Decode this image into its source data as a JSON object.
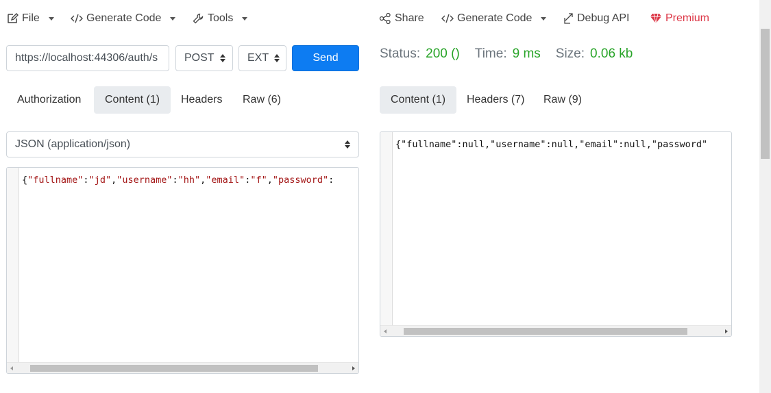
{
  "menu_left": {
    "file": "File",
    "generate_code": "Generate Code",
    "tools": "Tools"
  },
  "menu_right": {
    "share": "Share",
    "generate_code": "Generate Code",
    "debug_api": "Debug API",
    "premium": "Premium"
  },
  "request": {
    "url": "https://localhost:44306/auth/s",
    "method": "POST",
    "ext": "EXT",
    "send_label": "Send"
  },
  "request_tabs": [
    {
      "label": "Authorization",
      "active": false
    },
    {
      "label": "Content (1)",
      "active": true
    },
    {
      "label": "Headers",
      "active": false
    },
    {
      "label": "Raw (6)",
      "active": false
    }
  ],
  "content_type": "JSON (application/json)",
  "request_body": {
    "brace": "{",
    "k1": "\"fullname\"",
    "v1": "\"jd\"",
    "k2": "\"username\"",
    "v2": "\"hh\"",
    "k3": "\"email\"",
    "v3": "\"f\"",
    "k4": "\"password\"",
    "colon": ":",
    "comma": ","
  },
  "response": {
    "status_label": "Status:",
    "status_value": "200 ()",
    "time_label": "Time:",
    "time_value": "9 ms",
    "size_label": "Size:",
    "size_value": "0.06 kb"
  },
  "response_tabs": [
    {
      "label": "Content (1)",
      "active": true
    },
    {
      "label": "Headers (7)",
      "active": false
    },
    {
      "label": "Raw (9)",
      "active": false
    }
  ],
  "response_body": "{\"fullname\":null,\"username\":null,\"email\":null,\"password\"",
  "colors": {
    "accent": "#0d7cf2",
    "status_green": "#28a428",
    "premium_red": "#dc3545",
    "code_red": "#a31515"
  },
  "icons": {
    "file": "edit-icon",
    "generate_code": "code-icon",
    "tools": "wrench-icon",
    "share": "share-icon",
    "debug_api": "external-link-icon",
    "premium": "gem-icon"
  }
}
